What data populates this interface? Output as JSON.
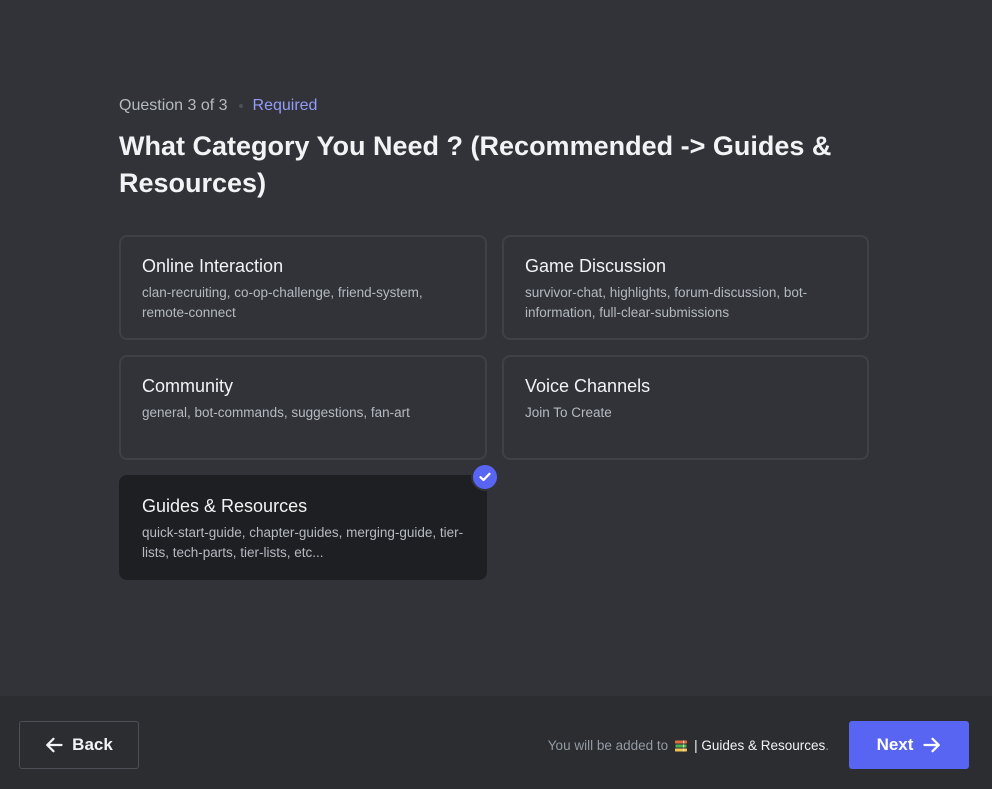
{
  "question": {
    "counter": "Question 3 of 3",
    "required_label": "Required",
    "title": "What Category You Need ? (Recommended -> Guides & Resources)"
  },
  "options": [
    {
      "title": "Online Interaction",
      "description": "clan-recruiting, co-op-challenge, friend-system, remote-connect",
      "selected": false
    },
    {
      "title": "Game Discussion",
      "description": "survivor-chat, highlights, forum-discussion, bot-information, full-clear-submissions",
      "selected": false
    },
    {
      "title": "Community",
      "description": "general, bot-commands, suggestions, fan-art",
      "selected": false
    },
    {
      "title": "Voice Channels",
      "description": "Join To Create",
      "selected": false
    },
    {
      "title": "Guides & Resources",
      "description": "quick-start-guide, chapter-guides, merging-guide, tier-lists, tech-parts, tier-lists, etc...",
      "selected": true
    }
  ],
  "footer": {
    "back_label": "Back",
    "added_prefix": "You will be added to",
    "channel_name": "| Guides & Resources",
    "added_suffix": ".",
    "next_label": "Next"
  },
  "icons": {
    "back": "arrow-left-icon",
    "next": "arrow-right-icon",
    "selected": "check-icon",
    "channel": "books-icon"
  },
  "colors": {
    "background": "#313338",
    "footer": "#2b2d31",
    "accent": "#5865f2",
    "required": "#949cf7",
    "selected_card": "#1e1f22"
  }
}
